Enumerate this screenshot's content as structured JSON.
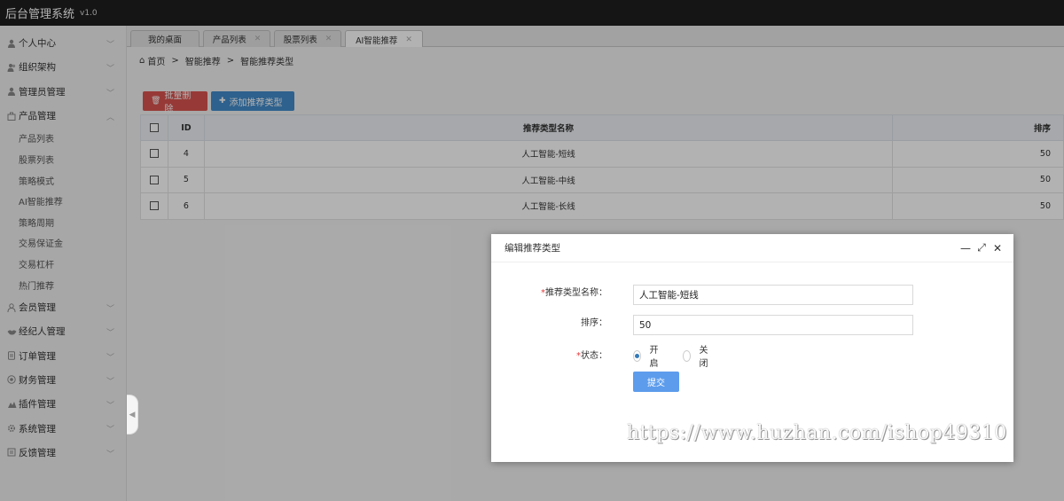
{
  "app": {
    "title": "后台管理系统",
    "version": "v1.0"
  },
  "sidebar": {
    "items": [
      {
        "label": "个人中心",
        "icon": "user-icon"
      },
      {
        "label": "组织架构",
        "icon": "users-icon"
      },
      {
        "label": "管理员管理",
        "icon": "user-icon"
      },
      {
        "label": "产品管理",
        "icon": "box-icon",
        "expanded": true,
        "children": [
          "产品列表",
          "股票列表",
          "策略模式",
          "AI智能推荐",
          "策略周期",
          "交易保证金",
          "交易杠杆",
          "热门推荐"
        ]
      },
      {
        "label": "会员管理",
        "icon": "member-icon"
      },
      {
        "label": "经纪人管理",
        "icon": "handshake-icon"
      },
      {
        "label": "订单管理",
        "icon": "order-icon"
      },
      {
        "label": "财务管理",
        "icon": "finance-icon"
      },
      {
        "label": "插件管理",
        "icon": "plugin-icon"
      },
      {
        "label": "系统管理",
        "icon": "gear-icon"
      },
      {
        "label": "反馈管理",
        "icon": "feedback-icon"
      }
    ]
  },
  "tabs": [
    {
      "label": "我的桌面",
      "closable": false
    },
    {
      "label": "产品列表",
      "closable": true
    },
    {
      "label": "股票列表",
      "closable": true
    },
    {
      "label": "AI智能推荐",
      "closable": true,
      "active": true
    }
  ],
  "breadcrumb": {
    "home": "首页",
    "level1": "智能推荐",
    "level2": "智能推荐类型",
    "separator": ">"
  },
  "toolbar": {
    "delete_label": "批量删除",
    "add_label": "添加推荐类型"
  },
  "table": {
    "headers": {
      "id": "ID",
      "name": "推荐类型名称",
      "sort": "排序"
    },
    "rows": [
      {
        "id": "4",
        "name": "人工智能-短线",
        "sort": "50"
      },
      {
        "id": "5",
        "name": "人工智能-中线",
        "sort": "50"
      },
      {
        "id": "6",
        "name": "人工智能-长线",
        "sort": "50"
      }
    ]
  },
  "modal": {
    "title": "编辑推荐类型",
    "name_label": "推荐类型名称：",
    "name_value": "人工智能-短线",
    "sort_label": "排序：",
    "sort_value": "50",
    "status_label": "状态：",
    "status_on": "开启",
    "status_off": "关闭",
    "status_selected": "开启",
    "submit_label": "提交",
    "required_mark": "*"
  },
  "watermark": "https://www.huzhan.com/ishop49310",
  "colors": {
    "danger": "#d9534f",
    "primary": "#428bca",
    "submit": "#5d9cec",
    "topbar": "#1f1f1f"
  }
}
